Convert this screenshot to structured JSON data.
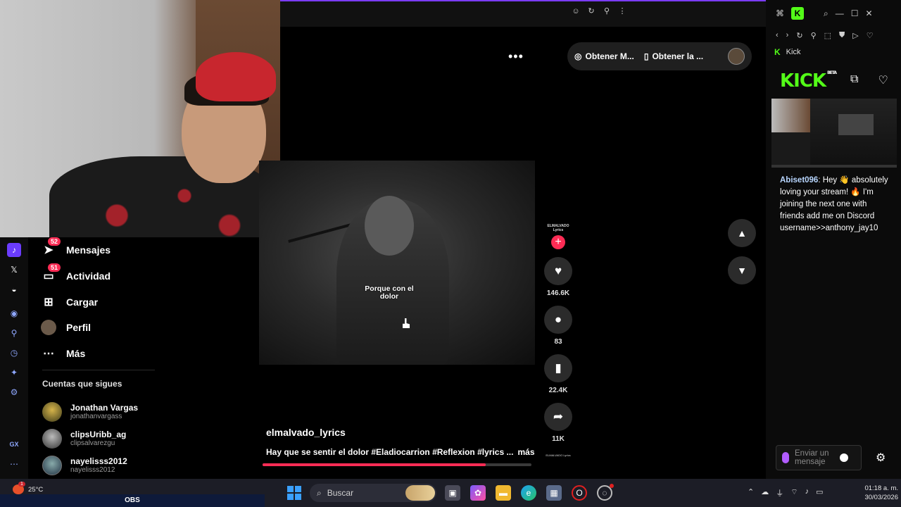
{
  "tiktok": {
    "nav": [
      {
        "label": "Mensajes",
        "badge": "52",
        "icon": "send-icon"
      },
      {
        "label": "Actividad",
        "badge": "51",
        "icon": "inbox-icon"
      },
      {
        "label": "Cargar",
        "badge": null,
        "icon": "plus-square-icon"
      },
      {
        "label": "Perfil",
        "badge": null,
        "icon": "profile-icon"
      },
      {
        "label": "Más",
        "badge": null,
        "icon": "more-icon"
      }
    ],
    "following_title": "Cuentas que sigues",
    "following": [
      {
        "name": "Jonathan Vargas",
        "handle": "jonathanvargass"
      },
      {
        "name": "clipsUribb_ag",
        "handle": "clipsalvarezgu"
      },
      {
        "name": "nayelisss2012",
        "handle": "nayelisss2012"
      }
    ],
    "top_actions": {
      "get_coins": "Obtener M...",
      "get_app": "Obtener la ..."
    },
    "video": {
      "caption": "Porque con el dolor",
      "username": "elmalvado_lyrics",
      "description": "Hay que se sentir el dolor #Eladiocarrion #Reflexion #lyrics ...",
      "more_label": "más",
      "progress": 0.83,
      "creator_tag": "ELMALVADO Lyrics",
      "disc_tag": "ELMALVADO Lyrics"
    },
    "counts": {
      "likes": "146.6K",
      "comments": "83",
      "saves": "22.4K",
      "shares": "11K"
    }
  },
  "kick": {
    "tab_label": "Kick",
    "logo": "KICK",
    "beta": "BETA",
    "chat": {
      "user": "Abiset096",
      "message": "Hey 👋 absolutely loving your stream! 🔥 I'm joining the next one with friends add me on Discord username>>anthony_jay10"
    },
    "input_placeholder": "Enviar un mensaje"
  },
  "taskbar": {
    "temperature": "25°C",
    "weather_badge": "1",
    "obs_label": "OBS",
    "search_placeholder": "Buscar",
    "time": "01:18 a. m.",
    "date": "30/03/2026"
  },
  "icon_strip": {
    "gx_label": "GX"
  },
  "colors": {
    "tiktok_red": "#fe2c55",
    "kick_green": "#53fc18",
    "opera_purple": "#6b3cff"
  }
}
